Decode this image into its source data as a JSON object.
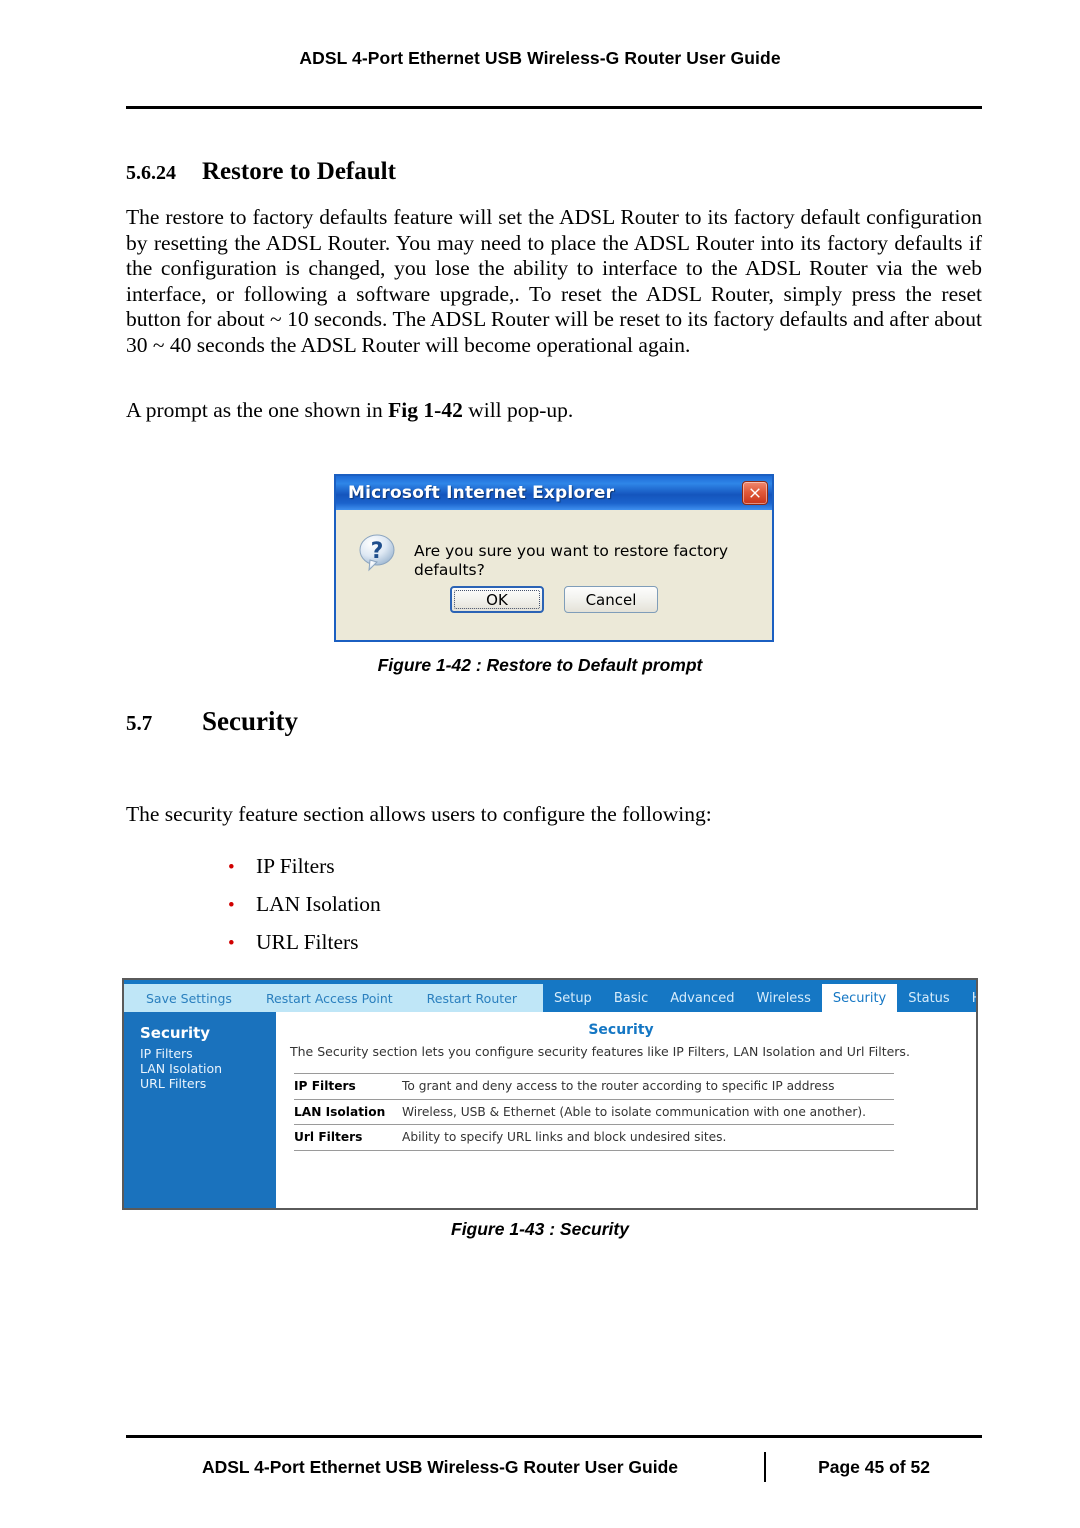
{
  "header": {
    "title": "ADSL 4-Port Ethernet USB Wireless-G Router User Guide"
  },
  "sections": {
    "restore": {
      "number": "5.6.24",
      "title": "Restore to Default",
      "paragraph": "The restore to factory defaults feature will set the ADSL Router to its factory default configuration by resetting the ADSL Router.  You may need to place the ADSL Router into its factory defaults if the configuration is changed, you lose the ability to interface to the ADSL Router via the web interface, or following a software upgrade,.  To reset the ADSL Router, simply press the reset button for about ~ 10 seconds.  The ADSL Router will be reset to its factory defaults and after about 30 ~ 40 seconds the ADSL Router will become operational again.",
      "prompt_pre": "A prompt as the one shown in ",
      "prompt_figref": "Fig  1-42",
      "prompt_post": " will pop-up."
    },
    "security": {
      "number": "5.7",
      "title": "Security",
      "intro": "The security feature section allows users to configure the following:",
      "bullets": [
        "IP Filters",
        "LAN Isolation",
        "URL Filters"
      ]
    }
  },
  "dialog": {
    "title": "Microsoft Internet Explorer",
    "message": "Are you sure you want to restore factory defaults?",
    "ok_label": "OK",
    "cancel_label": "Cancel",
    "close_icon": "close-icon",
    "question_icon": "question-bubble-icon",
    "titlebar_color": "#1455bd",
    "body_color": "#ece9d8",
    "close_color": "#c8341a"
  },
  "figures": {
    "fig_142": "Figure 1-42 : Restore to Default prompt",
    "fig_143": "Figure 1-43 : Security"
  },
  "router_ui": {
    "quick_actions": [
      "Save Settings",
      "Restart Access Point",
      "Restart Router"
    ],
    "tabs": [
      {
        "label": "Setup",
        "active": false
      },
      {
        "label": "Basic",
        "active": false
      },
      {
        "label": "Advanced",
        "active": false
      },
      {
        "label": "Wireless",
        "active": false
      },
      {
        "label": "Security",
        "active": true
      },
      {
        "label": "Status",
        "active": false
      },
      {
        "label": "Help",
        "active": false
      }
    ],
    "sidebar": {
      "title": "Security",
      "items": [
        "IP Filters",
        "LAN Isolation",
        "URL Filters"
      ]
    },
    "content": {
      "title": "Security",
      "description": "The Security section lets you configure security features like IP Filters, LAN Isolation and Url Filters.",
      "rows": [
        {
          "name": "IP Filters",
          "desc": "To grant and deny access to the router according to specific IP address"
        },
        {
          "name": "LAN Isolation",
          "desc": "Wireless, USB & Ethernet (Able to isolate communication with one another)."
        },
        {
          "name": "Url Filters",
          "desc": "Ability to specify URL links and block undesired sites."
        }
      ]
    },
    "accent_color": "#1577c4",
    "sidebar_color": "#1a72bd",
    "quickbar_color": "#bfe6f7"
  },
  "footer": {
    "title": "ADSL 4-Port Ethernet USB Wireless-G Router User Guide",
    "page": "Page 45 of 52"
  }
}
